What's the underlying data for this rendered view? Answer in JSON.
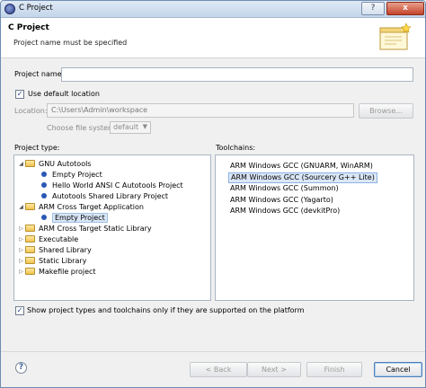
{
  "window": {
    "title": "C Project",
    "help_glyph": "?",
    "close_glyph": "x"
  },
  "banner": {
    "heading": "C Project",
    "message": "Project name must be specified"
  },
  "project_name": {
    "label": "Project name:",
    "value": ""
  },
  "use_default_location": {
    "label": "Use default location",
    "checked": true,
    "check_glyph": "✓"
  },
  "location": {
    "label": "Location:",
    "value": "C:\\Users\\Admin\\workspace",
    "browse_label": "Browse..."
  },
  "file_system": {
    "label": "Choose file system:",
    "value": "default",
    "arrow_glyph": "▼"
  },
  "project_type": {
    "label": "Project type:",
    "items": [
      {
        "label": "GNU Autotools",
        "kind": "folder",
        "expanded": true,
        "twisty": "◢"
      },
      {
        "label": "Empty Project",
        "kind": "leaf"
      },
      {
        "label": "Hello World ANSI C Autotools Project",
        "kind": "leaf"
      },
      {
        "label": "Autotools Shared Library Project",
        "kind": "leaf"
      },
      {
        "label": "ARM Cross Target Application",
        "kind": "folder",
        "expanded": true,
        "twisty": "◢"
      },
      {
        "label": "Empty Project",
        "kind": "leaf",
        "selected": true
      },
      {
        "label": "ARM Cross Target Static Library",
        "kind": "folder",
        "expanded": false,
        "twisty": "▷"
      },
      {
        "label": "Executable",
        "kind": "folder",
        "expanded": false,
        "twisty": "▷"
      },
      {
        "label": "Shared Library",
        "kind": "folder",
        "expanded": false,
        "twisty": "▷"
      },
      {
        "label": "Static Library",
        "kind": "folder",
        "expanded": false,
        "twisty": "▷"
      },
      {
        "label": "Makefile project",
        "kind": "folder",
        "expanded": false,
        "twisty": "▷"
      }
    ]
  },
  "toolchains": {
    "label": "Toolchains:",
    "items": [
      {
        "label": "ARM Windows GCC (GNUARM, WinARM)"
      },
      {
        "label": "ARM Windows GCC (Sourcery G++ Lite)",
        "selected": true
      },
      {
        "label": "ARM Windows GCC (Summon)"
      },
      {
        "label": "ARM Windows GCC (Yagarto)"
      },
      {
        "label": "ARM Windows GCC (devkitPro)"
      }
    ]
  },
  "show_supported": {
    "label": "Show project types and toolchains only if they are supported on the platform",
    "checked": true,
    "check_glyph": "✓"
  },
  "footer": {
    "help_glyph": "?",
    "back_label": "< Back",
    "next_label": "Next >",
    "finish_label": "Finish",
    "cancel_label": "Cancel"
  }
}
